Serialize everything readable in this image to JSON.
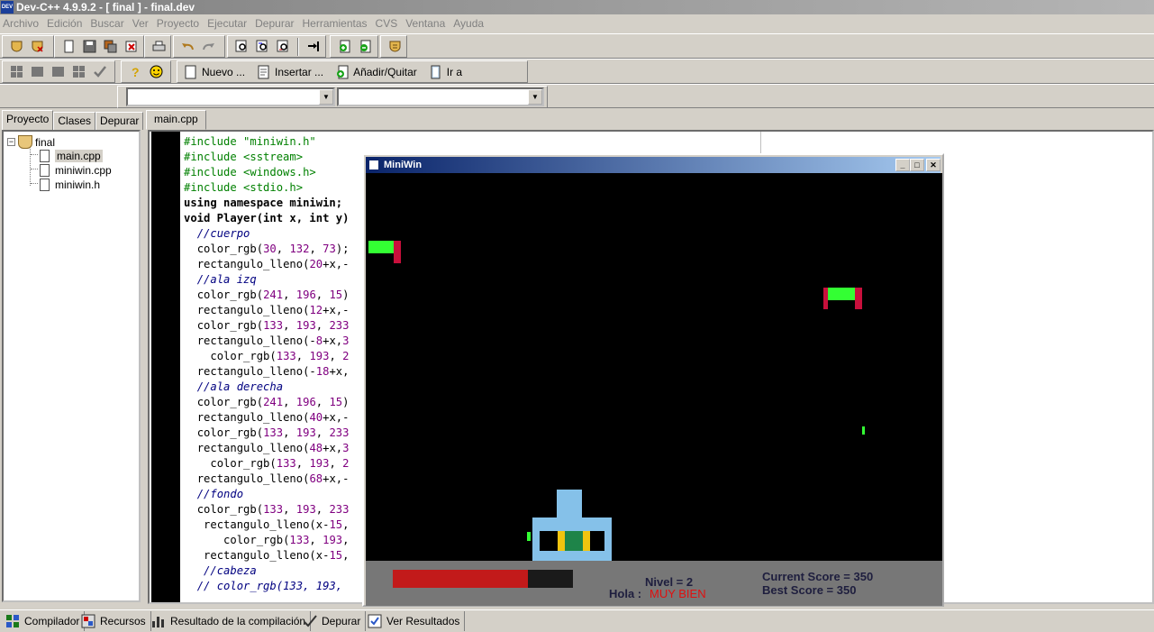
{
  "window": {
    "title": "Dev-C++ 4.9.9.2  -  [ final ] - final.dev",
    "icon_label": "DEV"
  },
  "menu": [
    "Archivo",
    "Edición",
    "Buscar",
    "Ver",
    "Proyecto",
    "Ejecutar",
    "Depurar",
    "Herramientas",
    "CVS",
    "Ventana",
    "Ayuda"
  ],
  "toolbar": {
    "new_label": "Nuevo ...",
    "insert_label": "Insertar ...",
    "add_remove_label": "Añadir/Quitar",
    "goto_label": "Ir a"
  },
  "left_panel": {
    "tabs": [
      "Proyecto",
      "Clases",
      "Depurar"
    ],
    "project_name": "final",
    "files": [
      "main.cpp",
      "miniwin.cpp",
      "miniwin.h"
    ],
    "selected_file": "main.cpp"
  },
  "editor": {
    "tab_label": "main.cpp",
    "lines": [
      {
        "indent": "",
        "kind": "pp",
        "text": "#include \"miniwin.h\""
      },
      {
        "indent": "",
        "kind": "pp",
        "text": "#include <sstream>"
      },
      {
        "indent": "",
        "kind": "pp",
        "text": "#include <windows.h>"
      },
      {
        "indent": "",
        "kind": "pp",
        "text": "#include <stdio.h>"
      },
      {
        "indent": "",
        "kind": "kw",
        "text": "using namespace miniwin;"
      },
      {
        "indent": "",
        "kind": "kw",
        "text": "void Player(int x, int y)"
      },
      {
        "indent": "  ",
        "kind": "cm",
        "text": "//cuerpo"
      },
      {
        "indent": "  ",
        "kind": "code",
        "text": "color_rgb(30, 132, 73);"
      },
      {
        "indent": "  ",
        "kind": "code",
        "text": "rectangulo_lleno(20+x,-"
      },
      {
        "indent": "  ",
        "kind": "cm",
        "text": "//ala izq"
      },
      {
        "indent": "  ",
        "kind": "code",
        "text": "color_rgb(241, 196, 15)"
      },
      {
        "indent": "  ",
        "kind": "code",
        "text": "rectangulo_lleno(12+x,-"
      },
      {
        "indent": "  ",
        "kind": "code",
        "text": "color_rgb(133, 193, 233"
      },
      {
        "indent": "  ",
        "kind": "code",
        "text": "rectangulo_lleno(-8+x,3"
      },
      {
        "indent": "    ",
        "kind": "code",
        "text": "color_rgb(133, 193, 2"
      },
      {
        "indent": "  ",
        "kind": "code",
        "text": "rectangulo_lleno(-18+x,"
      },
      {
        "indent": "  ",
        "kind": "cm",
        "text": "//ala derecha"
      },
      {
        "indent": "  ",
        "kind": "code",
        "text": "color_rgb(241, 196, 15)"
      },
      {
        "indent": "  ",
        "kind": "code",
        "text": "rectangulo_lleno(40+x,-"
      },
      {
        "indent": "  ",
        "kind": "code",
        "text": "color_rgb(133, 193, 233"
      },
      {
        "indent": "  ",
        "kind": "code",
        "text": "rectangulo_lleno(48+x,3"
      },
      {
        "indent": "    ",
        "kind": "code",
        "text": "color_rgb(133, 193, 2"
      },
      {
        "indent": "  ",
        "kind": "code",
        "text": "rectangulo_lleno(68+x,-"
      },
      {
        "indent": "  ",
        "kind": "cm",
        "text": "//fondo"
      },
      {
        "indent": "  ",
        "kind": "code",
        "text": "color_rgb(133, 193, 233"
      },
      {
        "indent": "   ",
        "kind": "code",
        "text": "rectangulo_lleno(x-15,"
      },
      {
        "indent": "      ",
        "kind": "code",
        "text": "color_rgb(133, 193,"
      },
      {
        "indent": "   ",
        "kind": "code",
        "text": "rectangulo_lleno(x-15,"
      },
      {
        "indent": "   ",
        "kind": "cm",
        "text": "//cabeza"
      },
      {
        "indent": "  ",
        "kind": "cm",
        "text": "// color_rgb(133, 193,"
      }
    ]
  },
  "miniwin": {
    "title": "MiniWin",
    "hud": {
      "level_text": "Nivel = 2",
      "greeting_label": "Hola :",
      "greeting_value": "MUY BIEN",
      "current_score": "Current Score = 350",
      "best_score": "Best Score = 350",
      "health_fraction": 0.75
    }
  },
  "bottom_tabs": [
    "Compilador",
    "Recursos",
    "Resultado de la compilación",
    "Depurar",
    "Ver Resultados"
  ],
  "colors": {
    "enemy_body": "#33ff33",
    "enemy_wing": "#c8103c",
    "ship_blue": "#85c1e9",
    "ship_green": "#1e8449",
    "ship_yellow": "#f1c40f",
    "health_red": "#c21a1a",
    "greeting_red": "#e01010"
  }
}
